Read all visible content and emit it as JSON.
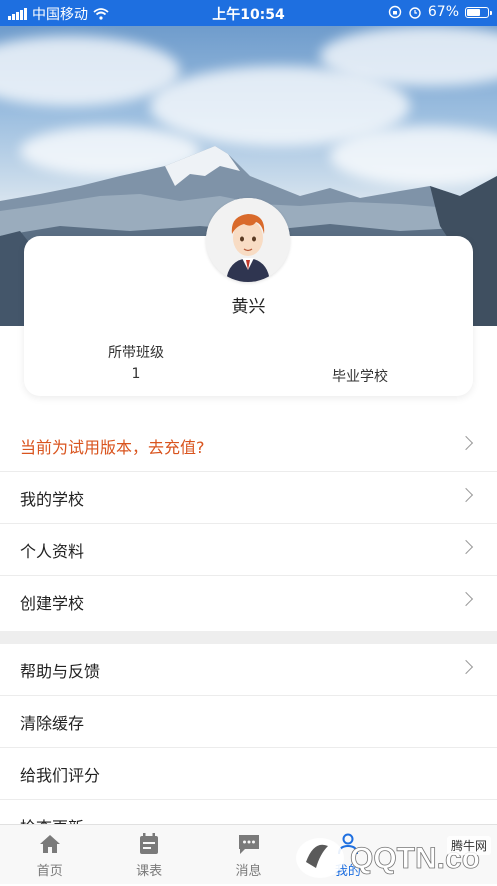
{
  "status_bar": {
    "carrier": "中国移动",
    "time": "上午10:54",
    "battery": "67%",
    "battery_level": 0.67
  },
  "profile": {
    "name": "黄兴",
    "class_label": "所带班级",
    "class_value": "1",
    "school_label": "毕业学校"
  },
  "menu_group_1": [
    {
      "label": "当前为试用版本，去充值?",
      "warn": true,
      "arrow": true
    },
    {
      "label": "我的学校",
      "arrow": true
    },
    {
      "label": "个人资料",
      "arrow": true
    },
    {
      "label": "创建学校",
      "arrow": true
    }
  ],
  "menu_group_2": [
    {
      "label": "帮助与反馈",
      "arrow": true
    },
    {
      "label": "清除缓存",
      "arrow": false
    },
    {
      "label": "给我们评分",
      "arrow": false
    },
    {
      "label": "检查更新",
      "arrow": false
    }
  ],
  "tabbar": {
    "tabs": [
      {
        "label": "首页",
        "icon": "home-icon"
      },
      {
        "label": "课表",
        "icon": "calendar-icon"
      },
      {
        "label": "消息",
        "icon": "message-icon"
      },
      {
        "label": "我的",
        "icon": "person-icon",
        "active": true
      }
    ]
  },
  "watermark": {
    "site_cn": "腾牛网",
    "logo_text": "QQTN.com"
  },
  "colors": {
    "accent": "#1e6fe0",
    "warn": "#d9541e"
  }
}
